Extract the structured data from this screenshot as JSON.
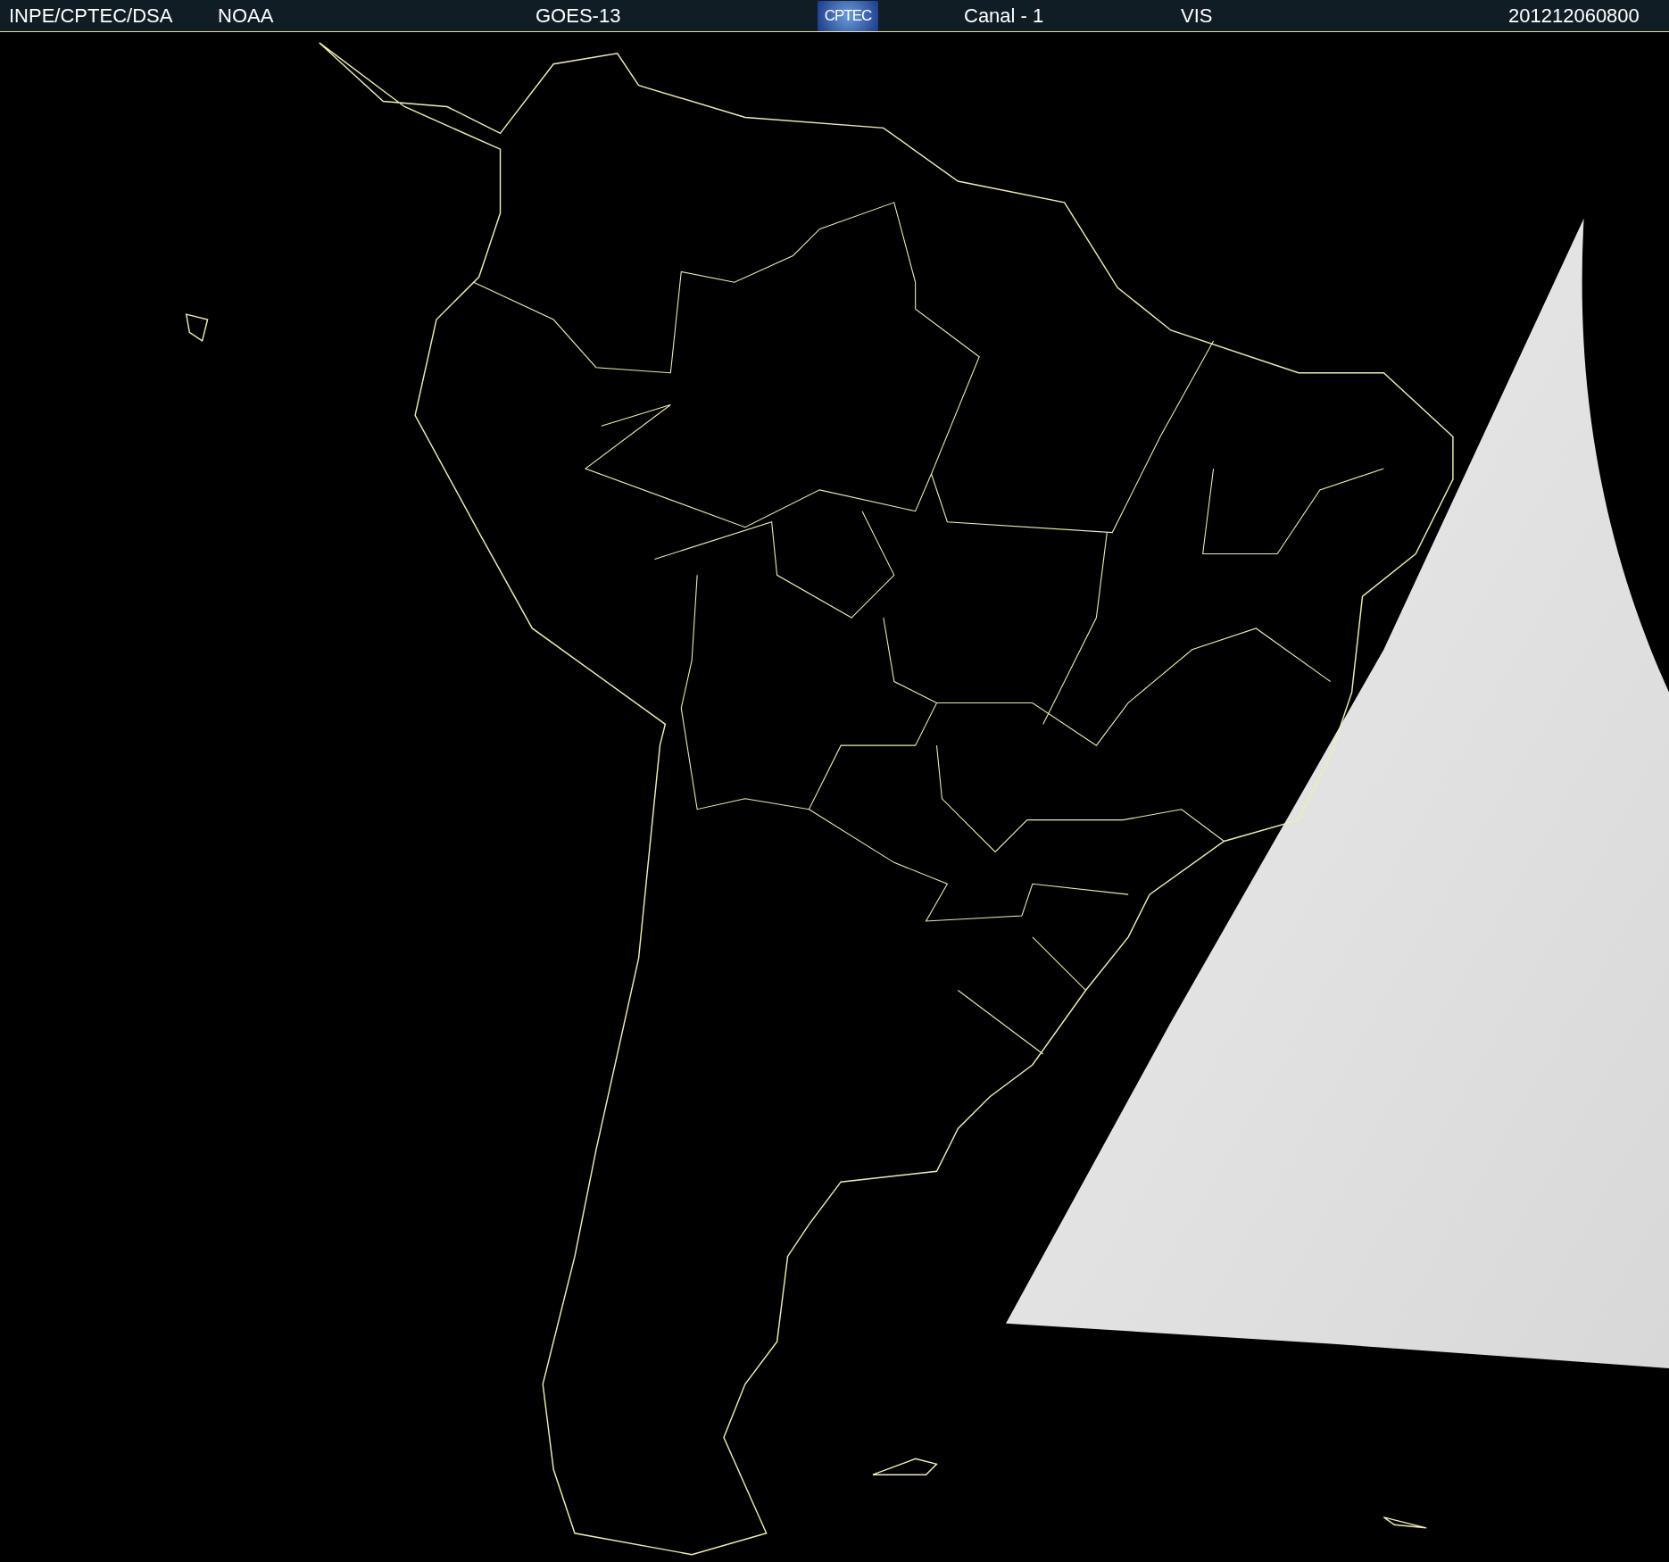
{
  "header": {
    "items": [
      {
        "kind": "text",
        "text": "INPE/CPTEC/DSA"
      },
      {
        "kind": "text",
        "text": "NOAA"
      },
      {
        "kind": "text",
        "text": "GOES-13"
      },
      {
        "kind": "logo",
        "text": "CPTEC"
      },
      {
        "kind": "text",
        "text": "Canal - 1"
      },
      {
        "kind": "text",
        "text": "VIS"
      },
      {
        "kind": "text",
        "text": "201212060800"
      }
    ]
  }
}
